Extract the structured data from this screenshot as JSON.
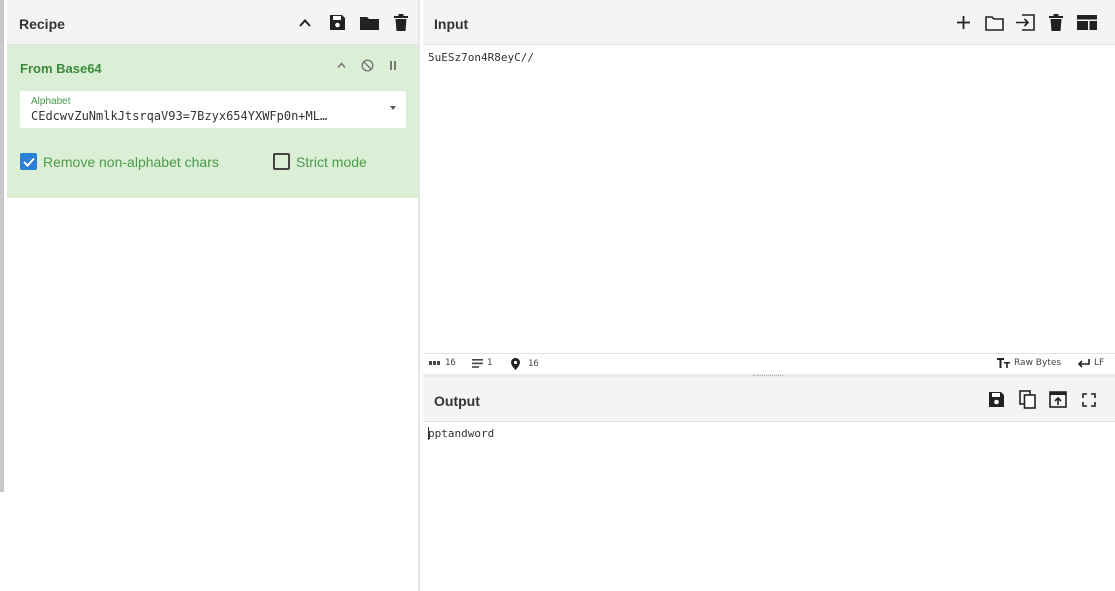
{
  "recipe": {
    "title": "Recipe",
    "header_icons": [
      "chevron-up-icon",
      "save-icon",
      "folder-icon",
      "trash-icon"
    ],
    "operation": {
      "name": "From Base64",
      "icons": [
        "chevron-up-icon",
        "disable-icon",
        "pause-icon"
      ],
      "alphabet": {
        "label": "Alphabet",
        "value": "CEdcwvZuNmlkJtsrqaV93=7Bzyx654YXWFp0n+ML…"
      },
      "options": [
        {
          "label": "Remove non-alphabet chars",
          "checked": true
        },
        {
          "label": "Strict mode",
          "checked": false
        }
      ]
    }
  },
  "input": {
    "title": "Input",
    "header_icons": [
      "plus-icon",
      "folder-icon",
      "import-icon",
      "trash-icon",
      "layout-icon"
    ],
    "text": "5uESz7on4R8eyC//",
    "status": {
      "length": "16",
      "lines": "1",
      "position": "16",
      "encoding": "Raw Bytes",
      "eol": "LF"
    }
  },
  "output": {
    "title": "Output",
    "header_icons": [
      "save-icon",
      "copy-icon",
      "replace-input-icon",
      "maximize-icon"
    ],
    "text": "pptandword"
  },
  "colors": {
    "operation_bg": "#dbefd6",
    "operation_text": "#3b8a3b",
    "checkbox_on": "#2a7fd6",
    "header_bg": "#f4f4f4"
  }
}
